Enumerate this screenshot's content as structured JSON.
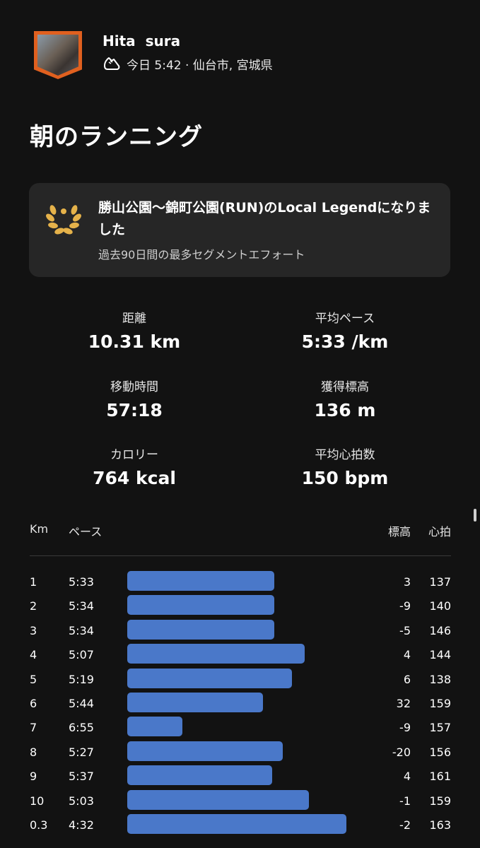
{
  "athlete": {
    "name": "Hita  sura",
    "meta": "今日 5:42 · 仙台市, 宮城県"
  },
  "activity_title": "朝のランニング",
  "achievement": {
    "title": "勝山公園〜錦町公園(RUN)のLocal Legendになりました",
    "subtitle": "過去90日間の最多セグメントエフォート"
  },
  "stats": [
    {
      "label": "距離",
      "value": "10.31 km"
    },
    {
      "label": "平均ペース",
      "value": "5:33 /km"
    },
    {
      "label": "移動時間",
      "value": "57:18"
    },
    {
      "label": "獲得標高",
      "value": "136 m"
    },
    {
      "label": "カロリー",
      "value": "764 kcal"
    },
    {
      "label": "平均心拍数",
      "value": "150 bpm"
    }
  ],
  "splits": {
    "headers": {
      "km": "Km",
      "pace": "ペース",
      "elev": "標高",
      "hr": "心拍"
    },
    "rows": [
      {
        "km": "1",
        "pace": "5:33",
        "pace_fraction": 0.67,
        "elev": "3",
        "hr": "137"
      },
      {
        "km": "2",
        "pace": "5:34",
        "pace_fraction": 0.67,
        "elev": "-9",
        "hr": "140"
      },
      {
        "km": "3",
        "pace": "5:34",
        "pace_fraction": 0.67,
        "elev": "-5",
        "hr": "146"
      },
      {
        "km": "4",
        "pace": "5:07",
        "pace_fraction": 0.81,
        "elev": "4",
        "hr": "144"
      },
      {
        "km": "5",
        "pace": "5:19",
        "pace_fraction": 0.75,
        "elev": "6",
        "hr": "138"
      },
      {
        "km": "6",
        "pace": "5:44",
        "pace_fraction": 0.62,
        "elev": "32",
        "hr": "159"
      },
      {
        "km": "7",
        "pace": "6:55",
        "pace_fraction": 0.25,
        "elev": "-9",
        "hr": "157"
      },
      {
        "km": "8",
        "pace": "5:27",
        "pace_fraction": 0.71,
        "elev": "-20",
        "hr": "156"
      },
      {
        "km": "9",
        "pace": "5:37",
        "pace_fraction": 0.66,
        "elev": "4",
        "hr": "161"
      },
      {
        "km": "10",
        "pace": "5:03",
        "pace_fraction": 0.83,
        "elev": "-1",
        "hr": "159"
      },
      {
        "km": "0.3",
        "pace": "4:32",
        "pace_fraction": 1.0,
        "elev": "-2",
        "hr": "163"
      }
    ]
  },
  "colors": {
    "background": "#121212",
    "bar": "#4a78c9",
    "card": "#262626",
    "avatar_border": "#e0601f",
    "laurel": "#e5b24a"
  },
  "icons": {
    "activity_type": "running-shoe-icon",
    "achievement": "laurel-wreath-icon"
  }
}
